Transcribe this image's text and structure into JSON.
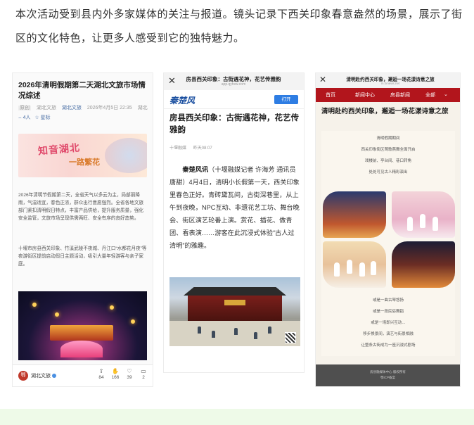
{
  "intro": {
    "text": "本次活动受到县内外多家媒体的关注与报道。镜头记录下西关印象春意盎然的场景，展示了街区的文化特色，让更多人感受到它的独特魅力。"
  },
  "article1": {
    "title": "2026年清明假期第二天湖北文旅市场情况综述",
    "tag": "原创",
    "source1": "湖北文旅",
    "source2": "湖北文旅",
    "date": "2026年4月5日 22:35",
    "location": "湖北",
    "listen": "4人",
    "star": "星标",
    "banner_line1": "知音湖北",
    "banner_line2": "一路繁花",
    "para1": "2026年清明节假期第二天，全省天气以多云为主，局部弱降雨，气温适宜，春色正浓，群众出行意愿强烈。全省各地文旅部门紧扣清明假日特点，丰富产品供给，提升服务质量，强化安全监管，文旅市场呈现供需两旺、安全有序的良好态势。",
    "para2": "十堰市房县西关印象、竹溪武陵不夜城、丹江口“水都花月夜”等夜游街区提前启动假日主题活动，吸引大量年轻游客与亲子家庭。",
    "account": "湖北文旅",
    "logo_text": "鄂",
    "stats": [
      "84",
      "166",
      "39",
      "2"
    ]
  },
  "article2": {
    "bar_title": "房县西关印象：古街遇花神，花艺传雅韵",
    "bar_url": "app.qyhxw.com",
    "brand": "秦楚风",
    "open_label": "打开",
    "title": "房县西关印象：古街遇花神，花艺传雅韵",
    "meta_source": "十堰融媒",
    "meta_time": "昨天08:07",
    "lead": "秦楚风讯",
    "body": "（十堰融媒记者 许海芳 通讯员 唐甜）4月4日，清明小长假第一天，西关印象里春色正好。青砖黛瓦间，古街深巷里，从上午到夜晚，NPC互动、非遗花艺工坊、舞台晚会、街区演艺轮番上演。赏花、插花、做青团、看表演……游客在此沉浸式体验“古人过清明”的雅趣。"
  },
  "article3": {
    "bar_title": "清明赴约西关印象，邂逅一场花漾诗意之旅",
    "bar_url": "m.fxnews.net",
    "nav": [
      "首页",
      "新闻中心",
      "房县新闻",
      "全部"
    ],
    "title": "清明赴约西关印象，邂逅一场花漾诗意之旅",
    "lines_top": [
      "清明假期期间",
      "西关印象街区莺歌燕舞全面开启",
      "戏楼前、亭台间、巷口转角",
      "处处可见古人精彩演出"
    ],
    "lines_bottom": [
      "或是一曲古琴悠扬",
      "或是一段民俗舞蹈",
      "或是一场即兴互动…",
      "移步换景间，演艺与街景相融",
      "让整条古街成为一座沉浸式剧场"
    ],
    "footer": [
      "房县融媒体中心 版权所有",
      "鄂ICP备案"
    ]
  }
}
